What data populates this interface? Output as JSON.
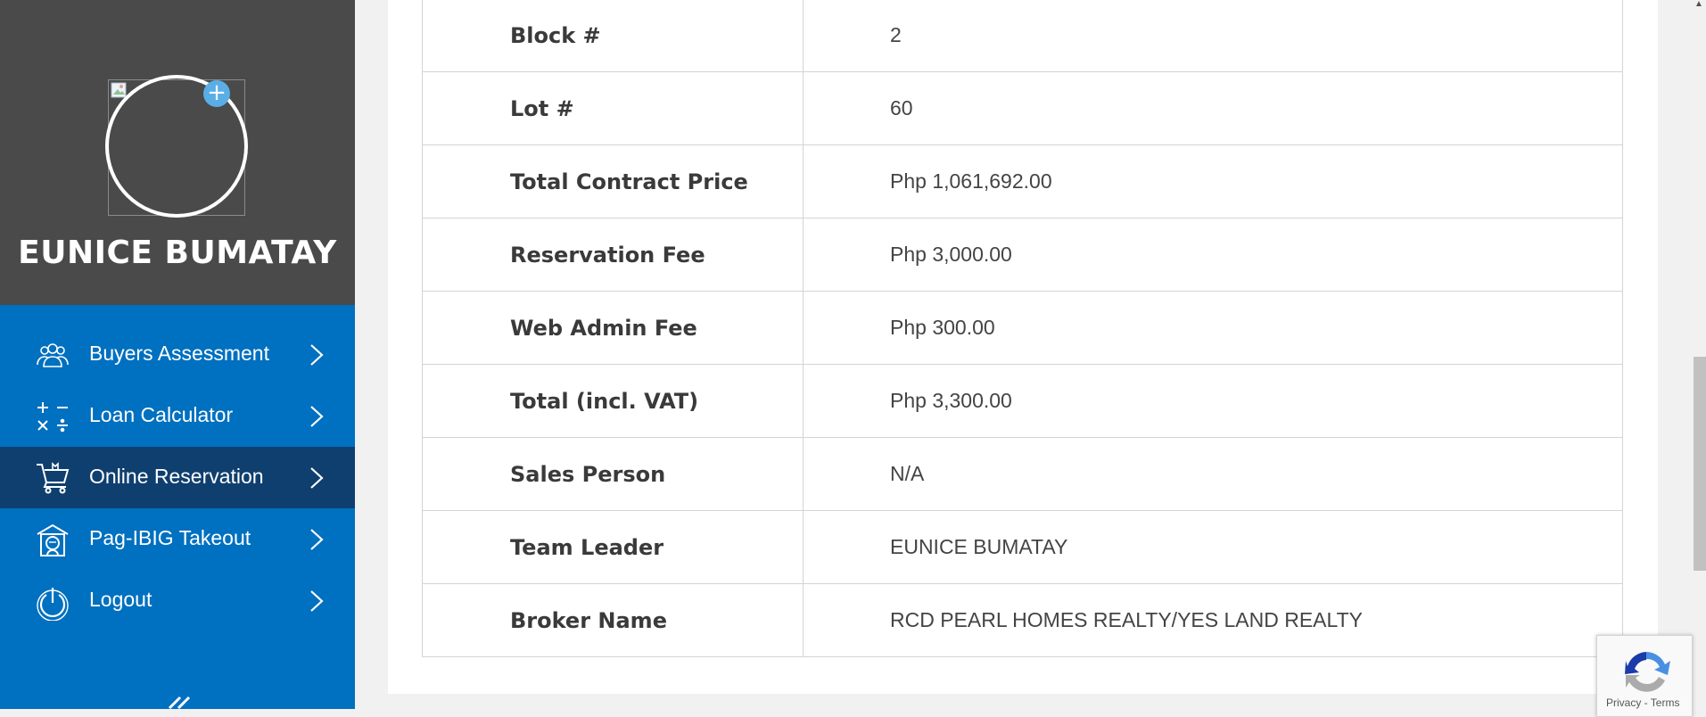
{
  "profile": {
    "name": "EUNICE BUMATAY",
    "add_photo_symbol": "+",
    "avatar_icon": "broken-image-icon"
  },
  "menu": {
    "items": [
      {
        "label": "Buyers Assessment",
        "icon": "users-icon",
        "active": false
      },
      {
        "label": "Loan Calculator",
        "icon": "calculator-icon",
        "active": false
      },
      {
        "label": "Online Reservation",
        "icon": "cart-icon",
        "active": true
      },
      {
        "label": "Pag-IBIG Takeout",
        "icon": "pagibig-house-icon",
        "active": false
      },
      {
        "label": "Logout",
        "icon": "power-icon",
        "active": false
      }
    ]
  },
  "details": {
    "rows": [
      {
        "label": "Block #",
        "value": "2"
      },
      {
        "label": "Lot #",
        "value": "60"
      },
      {
        "label": "Total Contract Price",
        "value": "Php 1,061,692.00"
      },
      {
        "label": "Reservation Fee",
        "value": "Php 3,000.00"
      },
      {
        "label": "Web Admin Fee",
        "value": "Php 300.00"
      },
      {
        "label": "Total (incl. VAT)",
        "value": "Php 3,300.00"
      },
      {
        "label": "Sales Person",
        "value": "N/A"
      },
      {
        "label": "Team Leader",
        "value": "EUNICE BUMATAY"
      },
      {
        "label": "Broker Name",
        "value": "RCD PEARL HOMES REALTY/YES LAND REALTY"
      }
    ]
  },
  "recaptcha": {
    "privacy": "Privacy",
    "separator": " - ",
    "terms": "Terms"
  },
  "colors": {
    "sidebar_blue": "#0070c0",
    "profile_bg": "#4a4a4a",
    "active_item": "#0f3f6e",
    "add_badge": "#5aaee6"
  }
}
